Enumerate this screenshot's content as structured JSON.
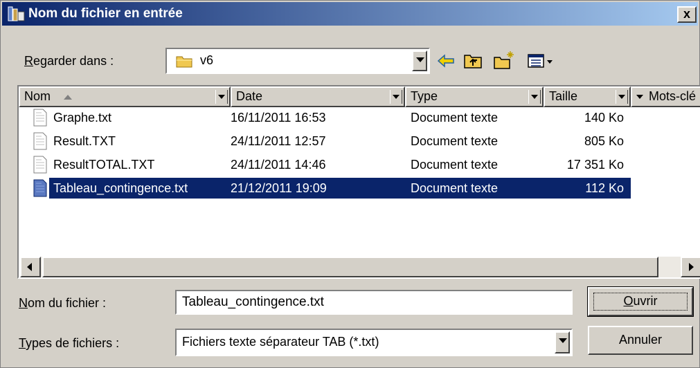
{
  "window": {
    "title": "Nom du fichier en entrée",
    "close_label": "x"
  },
  "lookin": {
    "label_first": "R",
    "label_rest": "egarder dans :",
    "value": "v6",
    "icons": [
      "folder-icon",
      "back-arrow-icon",
      "up-folder-icon",
      "new-folder-icon",
      "view-menu-icon"
    ]
  },
  "list": {
    "columns": [
      {
        "label": "Nom",
        "sort": "ascending"
      },
      {
        "label": "Date"
      },
      {
        "label": "Type"
      },
      {
        "label": "Taille"
      },
      {
        "label": "Mots-clé"
      }
    ],
    "rows": [
      {
        "name": "Graphe.txt",
        "date": "16/11/2011 16:53",
        "type": "Document texte",
        "size": "140 Ko",
        "selected": false
      },
      {
        "name": "Result.TXT",
        "date": "24/11/2011 12:57",
        "type": "Document texte",
        "size": "805 Ko",
        "selected": false
      },
      {
        "name": "ResultTOTAL.TXT",
        "date": "24/11/2011 14:46",
        "type": "Document texte",
        "size": "17 351 Ko",
        "selected": false
      },
      {
        "name": "Tableau_contingence.txt",
        "date": "21/12/2011 19:09",
        "type": "Document texte",
        "size": "112 Ko",
        "selected": true
      }
    ]
  },
  "filename": {
    "label_first": "N",
    "label_rest": "om du fichier :",
    "value": "Tableau_contingence.txt"
  },
  "filetype": {
    "label_first": "T",
    "label_rest": "ypes de fichiers :",
    "value": "Fichiers texte séparateur TAB (*.txt)"
  },
  "buttons": {
    "open_first": "O",
    "open_rest": "uvrir",
    "cancel": "Annuler"
  },
  "colors": {
    "title_start": "#0a246a",
    "title_end": "#a6caf0",
    "selection": "#0a246a",
    "face": "#d4d0c8"
  }
}
